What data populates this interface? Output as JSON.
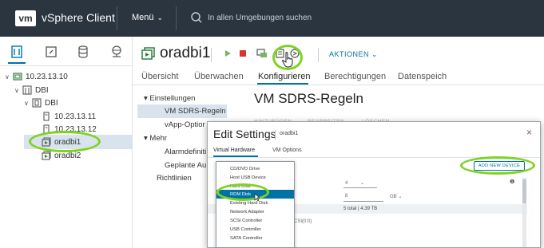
{
  "topbar": {
    "logo": "vm",
    "app_title": "vSphere Client",
    "menu_label": "Menü",
    "search_placeholder": "In allen Umgebungen suchen"
  },
  "tree": {
    "items": [
      {
        "label": "10.23.13.10"
      },
      {
        "label": "DBI"
      },
      {
        "label": "DBI"
      },
      {
        "label": "10.23.13.11"
      },
      {
        "label": "10.23.13.12"
      },
      {
        "label": "oradbi1"
      },
      {
        "label": "oradbi2"
      }
    ]
  },
  "header": {
    "title": "oradbi1",
    "actions_label": "AKTIONEN"
  },
  "tabs": [
    {
      "label": "Übersicht"
    },
    {
      "label": "Überwachen"
    },
    {
      "label": "Konfigurieren"
    },
    {
      "label": "Berechtigungen"
    },
    {
      "label": "Datenspeich"
    }
  ],
  "config_nav": {
    "einstellungen": "Einstellungen",
    "vm_sdrs": "VM SDRS-Regeln",
    "vapp": "vApp-Optior",
    "mehr": "Mehr",
    "alarm": "Alarmdefiniti",
    "geplante": "Geplante Au",
    "richtlinien": "Richtlinien"
  },
  "section_title": "VM SDRS-Regeln",
  "grey_columns": [
    "HINZUFÜGEN",
    "BEARBEITEN",
    "LÖSCHEN"
  ],
  "modal": {
    "title": "Edit Settings",
    "subtitle": "oradbi1",
    "close": "×",
    "tabs": [
      {
        "label": "Virtual Hardware"
      },
      {
        "label": "VM Options"
      }
    ],
    "add_device_label": "ADD NEW DEVICE",
    "cpu_value": "4",
    "memory_value": "8",
    "memory_unit": "GB",
    "disk_summary": "5 total | 4.39 TB",
    "scsi_text": "CSI(0:0)"
  },
  "dropdown": {
    "items": [
      {
        "label": "CD/DVD Drive"
      },
      {
        "label": "Host USB Device"
      },
      {
        "label": "Hard Disk"
      },
      {
        "label": "RDM Disk"
      },
      {
        "label": "Existing Hard Disk"
      },
      {
        "label": "Network Adapter"
      },
      {
        "label": "SCSI Controller"
      },
      {
        "label": "USB Controller"
      },
      {
        "label": "SATA Controller"
      }
    ],
    "highlighted_index": 3
  },
  "colors": {
    "topbar": "#2a3540",
    "accent": "#0072a3",
    "highlight_ring": "#7ed321",
    "selection": "#d8e3ed"
  }
}
